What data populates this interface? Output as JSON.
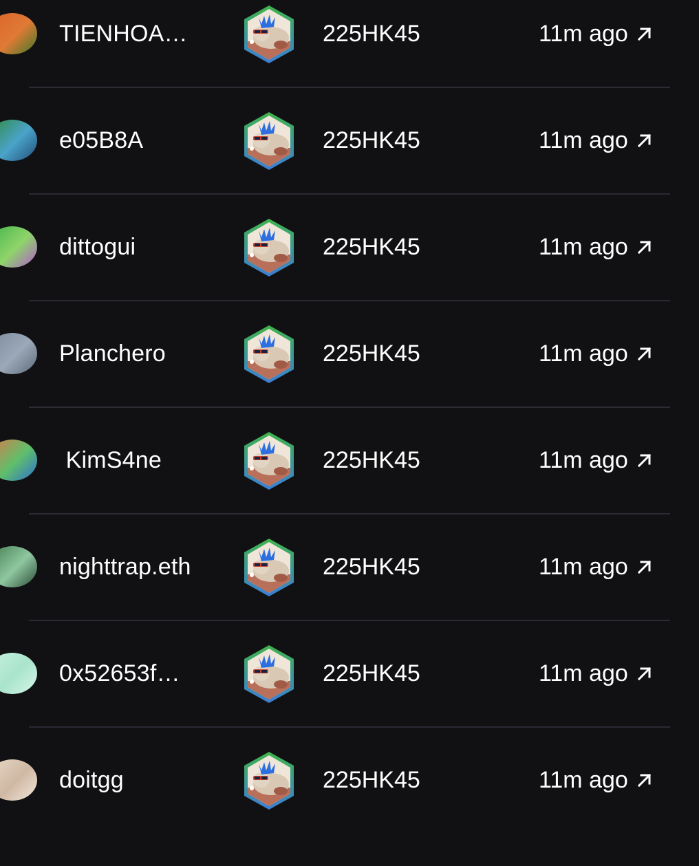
{
  "activity": {
    "rows": [
      {
        "username": "TIENHOA…",
        "token": "225HK45",
        "time": "11m ago",
        "avatar_colors": [
          "#d9622b",
          "#e07a35",
          "#3d7a2a"
        ],
        "arrow_icon": "arrow-up-right-icon"
      },
      {
        "username": "e05B8A",
        "token": "225HK45",
        "time": "11m ago",
        "avatar_colors": [
          "#2f8a3c",
          "#4aa3c9",
          "#214d7a"
        ],
        "arrow_icon": "arrow-up-right-icon"
      },
      {
        "username": "dittogui",
        "token": "225HK45",
        "time": "11m ago",
        "avatar_colors": [
          "#3fb34a",
          "#8fd46a",
          "#b05bd0"
        ],
        "arrow_icon": "arrow-up-right-icon"
      },
      {
        "username": "Planchero",
        "token": "225HK45",
        "time": "11m ago",
        "avatar_colors": [
          "#7c8a9c",
          "#9aa8b8",
          "#5d6a7a"
        ],
        "arrow_icon": "arrow-up-right-icon"
      },
      {
        "username": " KimS4ne",
        "token": "225HK45",
        "time": "11m ago",
        "avatar_colors": [
          "#e0784a",
          "#5fbf6a",
          "#2c6fd1"
        ],
        "arrow_icon": "arrow-up-right-icon"
      },
      {
        "username": "nighttrap.eth",
        "token": "225HK45",
        "time": "11m ago",
        "avatar_colors": [
          "#3f7a4a",
          "#8fc7a0",
          "#2a4a35"
        ],
        "arrow_icon": "arrow-up-right-icon"
      },
      {
        "username": "0x52653f…",
        "token": "225HK45",
        "time": "11m ago",
        "avatar_colors": [
          "#c9f0df",
          "#a9e4cc",
          "#d8f6e9"
        ],
        "arrow_icon": "arrow-up-right-icon"
      },
      {
        "username": "doitgg",
        "token": "225HK45",
        "time": "11m ago",
        "avatar_colors": [
          "#e9d9c9",
          "#cfb8a3",
          "#f2e6da"
        ],
        "arrow_icon": "arrow-up-right-icon"
      }
    ],
    "nft_icon": "hexagon-nft-icon",
    "colors": {
      "background": "#111113",
      "divider": "#2a2b33",
      "text": "#ffffff",
      "hex_border_top": "#3fb34a",
      "hex_border_bottom": "#3b7fd8"
    }
  }
}
